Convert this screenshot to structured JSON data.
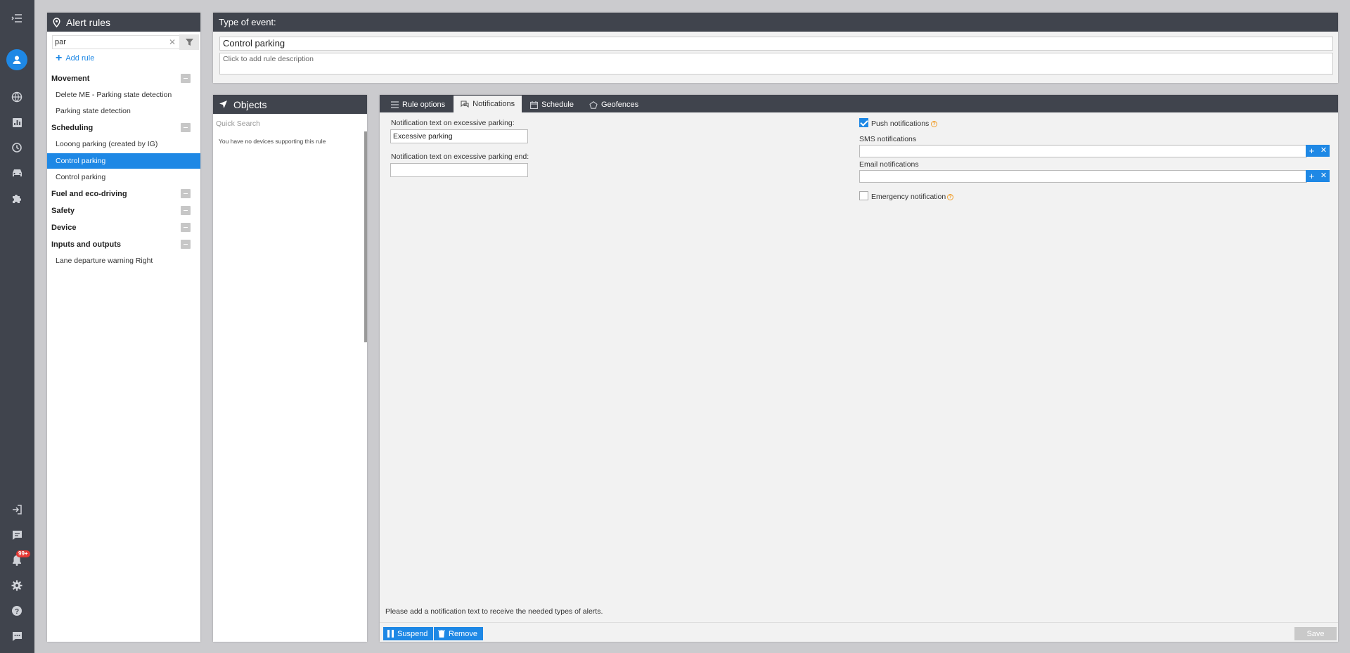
{
  "nav": {
    "icons": [
      "menu-icon",
      "user-avatar-icon",
      "globe-icon",
      "chart-icon",
      "map-pin-icon",
      "car-icon",
      "puzzle-icon",
      "logout-icon",
      "message-icon",
      "bell-icon",
      "gear-icon",
      "help-icon",
      "chat-icon"
    ],
    "notification_badge": "99+"
  },
  "rules_panel": {
    "title": "Alert rules",
    "search_value": "par",
    "add_rule_label": "Add rule",
    "groups": [
      {
        "name": "Movement",
        "items": [
          "Delete ME - Parking state detection",
          "Parking state detection"
        ]
      },
      {
        "name": "Scheduling",
        "items": [
          "Looong parking (created by IG)",
          "Control parking",
          "Control parking"
        ]
      },
      {
        "name": "Fuel and eco-driving",
        "items": []
      },
      {
        "name": "Safety",
        "items": []
      },
      {
        "name": "Device",
        "items": []
      },
      {
        "name": "Inputs and outputs",
        "items": [
          "Lane departure warning Right"
        ]
      }
    ],
    "selected_item": "Control parking"
  },
  "event": {
    "header": "Type of event:",
    "name": "Control parking",
    "description_placeholder": "Click to add rule description"
  },
  "objects": {
    "title": "Objects",
    "search_placeholder": "Quick Search",
    "empty_message": "You have no devices supporting this rule"
  },
  "tabs": [
    {
      "label": "Rule options",
      "icon": "list-icon"
    },
    {
      "label": "Notifications",
      "icon": "notification-icon",
      "active": true
    },
    {
      "label": "Schedule",
      "icon": "calendar-icon"
    },
    {
      "label": "Geofences",
      "icon": "pentagon-icon"
    }
  ],
  "notifications": {
    "excessive_label": "Notification text on excessive parking:",
    "excessive_value": "Excessive parking",
    "excessive_end_label": "Notification text on excessive parking end:",
    "excessive_end_value": "",
    "push_label": "Push notifications",
    "push_checked": true,
    "sms_label": "SMS notifications",
    "email_label": "Email notifications",
    "emergency_label": "Emergency notification",
    "emergency_checked": false,
    "hint": "Please add a notification text to receive the needed types of alerts."
  },
  "footer": {
    "suspend_label": "Suspend",
    "remove_label": "Remove",
    "save_label": "Save"
  },
  "colors": {
    "accent": "#1e88e5",
    "header_bg": "#40444d",
    "badge": "#e53935"
  }
}
